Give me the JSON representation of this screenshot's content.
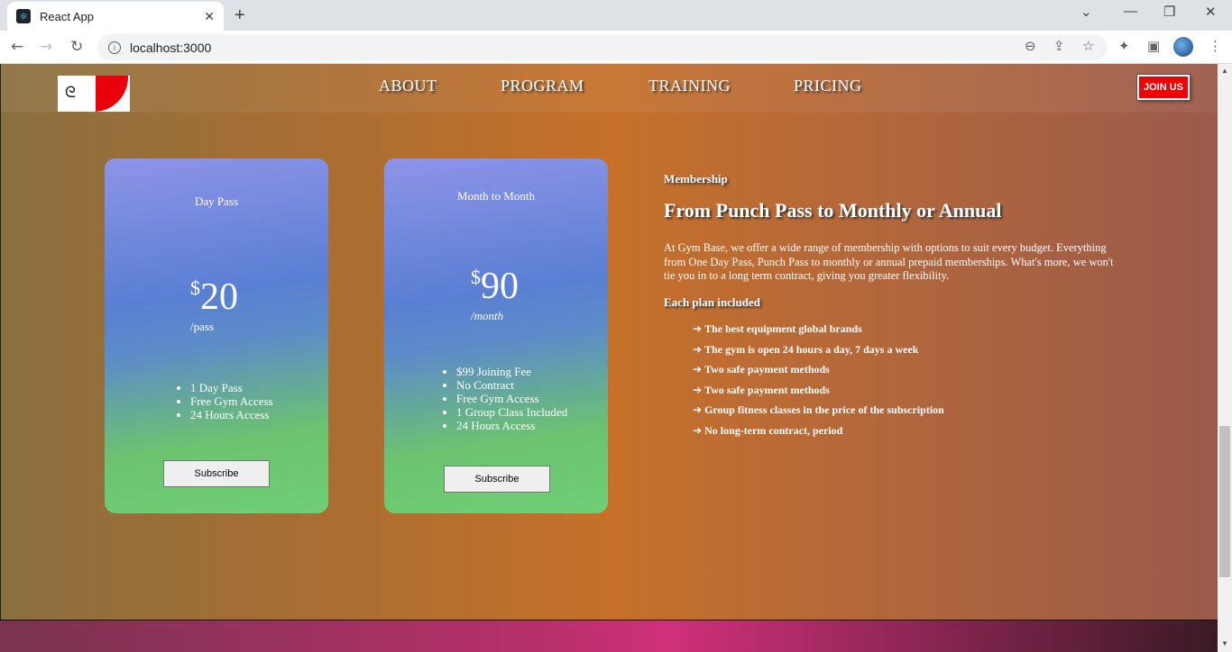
{
  "browser": {
    "tab_title": "React App",
    "new_tab": "+",
    "url": "localhost:3000",
    "back": "←",
    "forward": "→",
    "reload": "↻"
  },
  "header": {
    "nav": [
      "ABOUT",
      "PROGRAM",
      "TRAINING",
      "PRICING"
    ],
    "join_label": "JOIN US"
  },
  "cards": [
    {
      "title": "Day Pass",
      "currency": "$",
      "price": "20",
      "per": "/pass",
      "features": [
        "1 Day Pass",
        "Free Gym Access",
        "24 Hours Access"
      ],
      "button": "Subscribe"
    },
    {
      "title": "Month to Month",
      "currency": "$",
      "price": "90",
      "per": "/month",
      "features": [
        "$99 Joining Fee",
        "No Contract",
        "Free Gym Access",
        "1 Group Class Included",
        "24 Hours Access"
      ],
      "button": "Subscribe"
    }
  ],
  "membership": {
    "label": "Membership",
    "headline": "From Punch Pass to Monthly or Annual",
    "description": "At Gym Base, we offer a wide range of membership with options to suit every budget. Everything from One Day Pass, Punch Pass to monthly or annual prepaid memberships. What's more, we won't tie you in to a long term contract, giving you greater flexibility.",
    "included_label": "Each plan included",
    "benefits": [
      "The best equipment global brands",
      "The gym is open 24 hours a day, 7 days a week",
      "Two safe payment methods",
      "Two safe payment methods",
      "Group fitness classes in the price of the subscription",
      "No long-term contract, period"
    ]
  }
}
